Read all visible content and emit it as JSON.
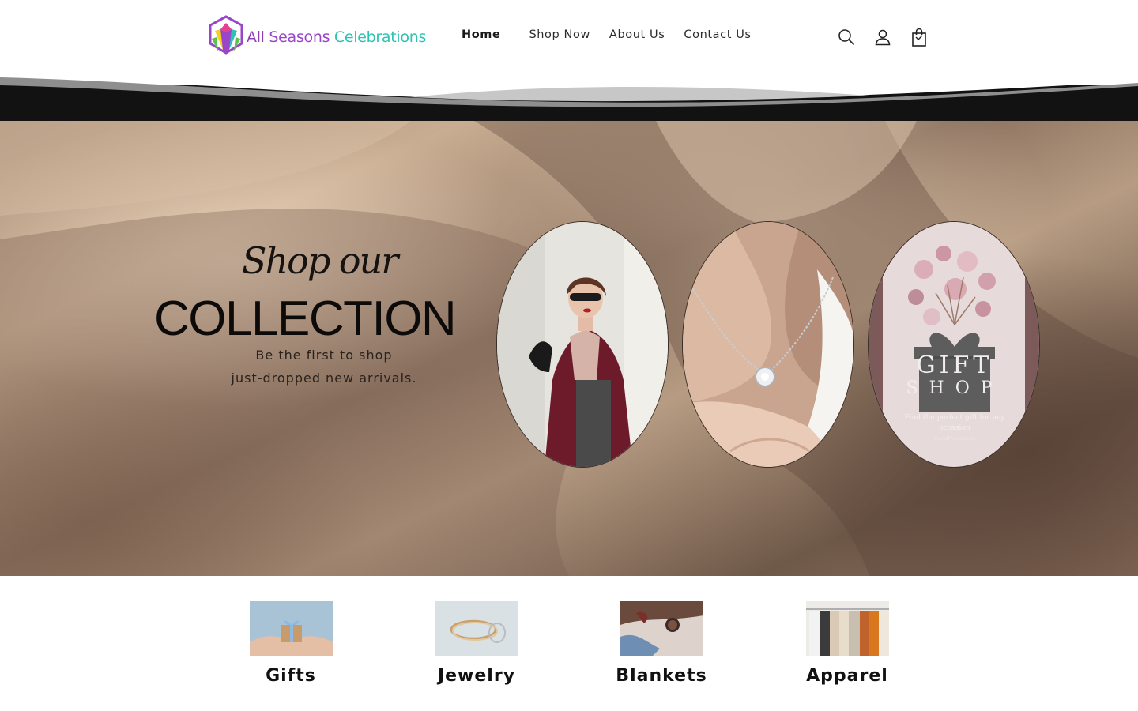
{
  "brand": {
    "name_part1": "All",
    "name_part2": "Seasons",
    "name_part3": "Celebrations",
    "colors": {
      "purple": "#9a46c9",
      "teal": "#2fc2b4",
      "pink": "#e6418f",
      "yellow": "#f2d21a",
      "green": "#5cc24a"
    }
  },
  "nav": {
    "items": [
      {
        "label": "Home",
        "active": true
      },
      {
        "label": "Shop Now",
        "active": false
      },
      {
        "label": "About Us",
        "active": false
      },
      {
        "label": "Contact Us",
        "active": false
      }
    ]
  },
  "header_icons": [
    "search-icon",
    "account-icon",
    "cart-icon"
  ],
  "hero": {
    "kicker": "Shop our",
    "title": "COLLECTION",
    "subtitle_line1": "Be the first to shop",
    "subtitle_line2": "just-dropped new arrivals.",
    "tiles": [
      {
        "name": "fashion-woman"
      },
      {
        "name": "necklace"
      },
      {
        "name": "gift-shop",
        "title_line1": "GIFT",
        "title_line2": "SHOP",
        "caption": "Find the perfect gift for any occasion",
        "handle": "#reallygreatsite"
      }
    ]
  },
  "categories": [
    {
      "label": "Gifts"
    },
    {
      "label": "Jewelry"
    },
    {
      "label": "Blankets"
    },
    {
      "label": "Apparel"
    }
  ]
}
